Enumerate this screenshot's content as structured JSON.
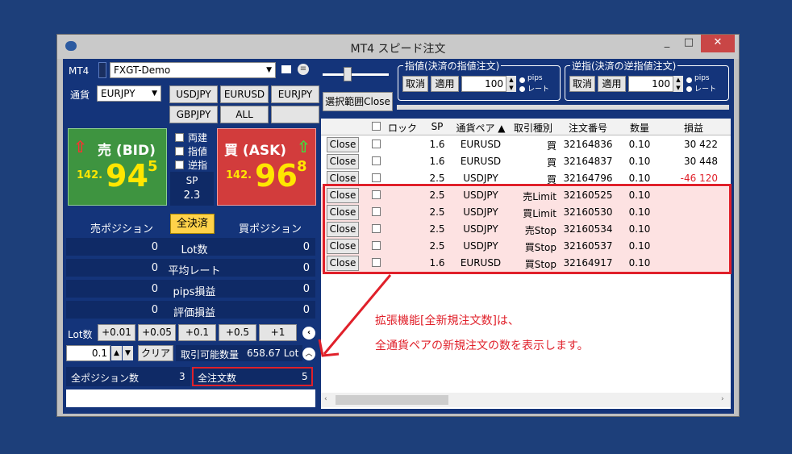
{
  "window": {
    "title": "MT4 スピード注文",
    "minimize": "_",
    "maximize": "□",
    "close": "✕"
  },
  "top": {
    "mt4_label": "MT4",
    "account": "FXGT-Demo",
    "currency_label": "通貨",
    "currency": "EURJPY",
    "pair_buttons": [
      "USDJPY",
      "EURUSD",
      "EURJPY",
      "GBPJPY",
      "ALL"
    ]
  },
  "bid": {
    "label": "売 (BID)",
    "prefix": "142.",
    "big": "94",
    "sup": "5"
  },
  "ask": {
    "label": "買 (ASK)",
    "prefix": "142.",
    "big": "96",
    "sup": "8"
  },
  "checks": [
    "両建",
    "指値",
    "逆指"
  ],
  "spread": {
    "label": "SP",
    "value": "2.3"
  },
  "positions": {
    "sell_label": "売ポジション",
    "close_all": "全決済",
    "buy_label": "買ポジション",
    "rows": [
      {
        "left": "0",
        "label": "Lot数",
        "right": "0"
      },
      {
        "left": "0",
        "label": "平均レート",
        "right": "0"
      },
      {
        "left": "0",
        "label": "pips損益",
        "right": "0"
      },
      {
        "left": "0",
        "label": "評価損益",
        "right": "0"
      }
    ]
  },
  "lot": {
    "label": "Lot数",
    "steps": [
      "+0.01",
      "+0.05",
      "+0.1",
      "+0.5",
      "+1"
    ],
    "value": "0.1",
    "clear": "クリア",
    "available_label": "取引可能数量",
    "available_value": "658.67 Lot"
  },
  "footer": {
    "all_positions_label": "全ポジション数",
    "all_positions_value": "3",
    "all_orders_label": "全注文数",
    "all_orders_value": "5"
  },
  "limit_group": {
    "title": "指値(決済の指値注文)",
    "cancel": "取消",
    "apply": "適用",
    "value": "100",
    "opt1": "pips",
    "opt2": "レート"
  },
  "stop_group": {
    "title": "逆指(決済の逆指値注文)",
    "cancel": "取消",
    "apply": "適用",
    "value": "100",
    "opt1": "pips",
    "opt2": "レート"
  },
  "select_close": "選択範囲Close",
  "table": {
    "headers": [
      "ロック",
      "SP",
      "通貨ペア ▲",
      "取引種別",
      "注文番号",
      "数量",
      "損益"
    ],
    "rows": [
      {
        "close": "Close",
        "sp": "1.6",
        "pair": "EURUSD",
        "type": "買",
        "order": "32164836",
        "qty": "0.10",
        "pl": "30 422",
        "neg": false,
        "hl": false
      },
      {
        "close": "Close",
        "sp": "1.6",
        "pair": "EURUSD",
        "type": "買",
        "order": "32164837",
        "qty": "0.10",
        "pl": "30 448",
        "neg": false,
        "hl": false
      },
      {
        "close": "Close",
        "sp": "2.5",
        "pair": "USDJPY",
        "type": "買",
        "order": "32164796",
        "qty": "0.10",
        "pl": "-46 120",
        "neg": true,
        "hl": false
      },
      {
        "close": "Close",
        "sp": "2.5",
        "pair": "USDJPY",
        "type": "売Limit",
        "order": "32160525",
        "qty": "0.10",
        "pl": "",
        "neg": false,
        "hl": true
      },
      {
        "close": "Close",
        "sp": "2.5",
        "pair": "USDJPY",
        "type": "買Limit",
        "order": "32160530",
        "qty": "0.10",
        "pl": "",
        "neg": false,
        "hl": true
      },
      {
        "close": "Close",
        "sp": "2.5",
        "pair": "USDJPY",
        "type": "売Stop",
        "order": "32160534",
        "qty": "0.10",
        "pl": "",
        "neg": false,
        "hl": true
      },
      {
        "close": "Close",
        "sp": "2.5",
        "pair": "USDJPY",
        "type": "買Stop",
        "order": "32160537",
        "qty": "0.10",
        "pl": "",
        "neg": false,
        "hl": true
      },
      {
        "close": "Close",
        "sp": "1.6",
        "pair": "EURUSD",
        "type": "買Stop",
        "order": "32164917",
        "qty": "0.10",
        "pl": "",
        "neg": false,
        "hl": true
      }
    ]
  },
  "annotation": {
    "line1": "拡張機能[全新規注文数]は、",
    "line2": "全通貨ペアの新規注文の数を表示します。"
  },
  "colors": {
    "highlight": "#e0202a",
    "background": "#1d3f7a",
    "bid": "#3e9440",
    "ask": "#d23c3c",
    "price": "#ffe600"
  }
}
